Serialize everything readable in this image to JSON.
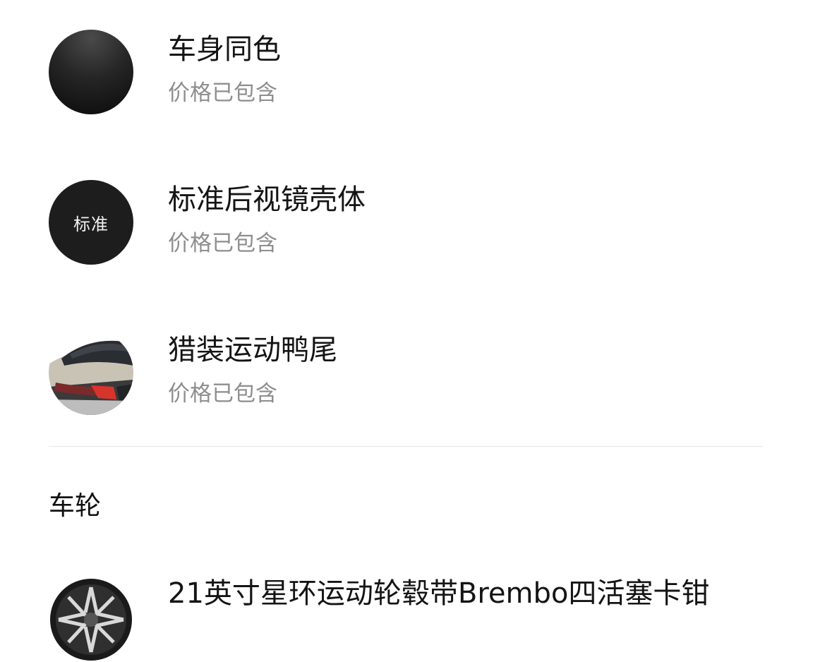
{
  "options": [
    {
      "title": "车身同色",
      "subtitle": "价格已包含",
      "swatch": "glossy-black-circle"
    },
    {
      "title": "标准后视镜壳体",
      "subtitle": "价格已包含",
      "swatch_label": "标准",
      "swatch": "black-circle-with-label"
    },
    {
      "title": "猎装运动鸭尾",
      "subtitle": "价格已包含",
      "swatch": "car-rear-photo"
    }
  ],
  "wheels_section": {
    "title": "车轮",
    "items": [
      {
        "title": "21英寸星环运动轮毂带Brembo四活塞卡钳",
        "swatch": "wheel-rim-photo"
      }
    ]
  },
  "colors": {
    "title_text": "#141414",
    "subtitle_text": "#8e8e8e",
    "divider": "#e6e6e6",
    "swatch_dark": "#1d1d1d"
  }
}
